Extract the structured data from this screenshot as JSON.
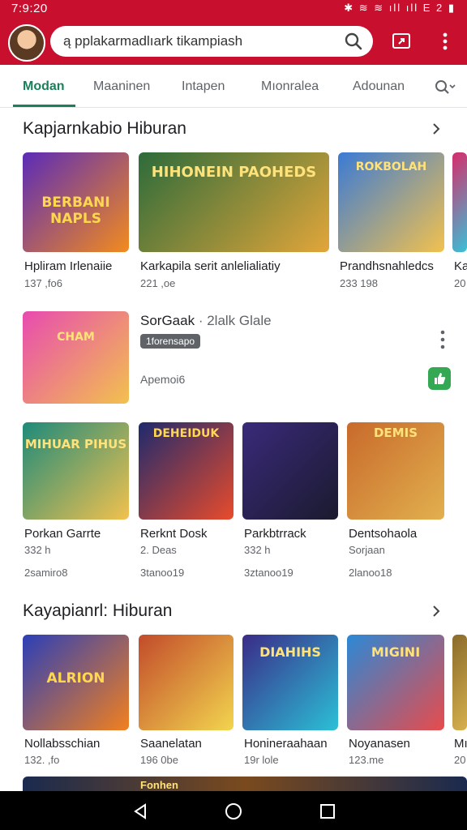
{
  "status_bar": {
    "time": "7:9:20",
    "icons": "✱ ≋ ≋ ıll ıll E 2 ▮"
  },
  "search": {
    "query": "ą pplakarmadlıark tikampiash"
  },
  "tabs": [
    "Modan",
    "Maaninen",
    "Intapen",
    "Mıonralea",
    "Adounan"
  ],
  "colors": {
    "brand": "#c8102e",
    "accent": "#1a7f5a",
    "install": "#34a853"
  },
  "sections": [
    {
      "title": "Kapjarnkabio Hiburan",
      "items": [
        {
          "name": "Hpliram Irlenaiie",
          "meta": "137 ,fo6",
          "art": "BERBANI NAPLS",
          "c1": "#5b2bb8",
          "c2": "#f28b1e"
        },
        {
          "name": "Karkapila serit anlelialiatiy",
          "meta": "221 ,oe",
          "art": "HIHONEIN PAOHEDS",
          "c1": "#2d6b3a",
          "c2": "#e2a63a"
        },
        {
          "name": "Prandhsnahledcs",
          "meta": "233 198",
          "art": "ROKBOLAH",
          "c1": "#3a7ad6",
          "c2": "#f2c14e"
        },
        {
          "name": "Ka",
          "meta": "20",
          "art": "",
          "c1": "#d62d6b",
          "c2": "#3ac0d6"
        }
      ]
    },
    {
      "title": "Kayapianrl: Hiburan",
      "items": [
        {
          "name": "Nollabsschian",
          "meta": "132. ,fo",
          "art": "ALRION",
          "c1": "#2b3fb8",
          "c2": "#f2801e"
        },
        {
          "name": "Saanelatan",
          "meta": "196 0be",
          "art": "",
          "c1": "#c24b2b",
          "c2": "#f2d54e"
        },
        {
          "name": "Honineraahaan",
          "meta": "19r lole",
          "art": "DIAHIHS",
          "c1": "#3a2b88",
          "c2": "#2bc0d6"
        },
        {
          "name": "Noyanasen",
          "meta": "123.me",
          "art": "MIGINI",
          "c1": "#2b88d6",
          "c2": "#e84b4b"
        },
        {
          "name": "Mı",
          "meta": "20",
          "art": "",
          "c1": "#8a6b2b",
          "c2": "#d6b04e"
        }
      ]
    }
  ],
  "featured": {
    "name": "SorGaak",
    "subtitle": "· 2lalk Glale",
    "badge": "1forensapo",
    "meta": "Apemoi6",
    "art": "CHAM"
  },
  "grid_row": [
    {
      "name": "Porkan Garrte",
      "meta1": "332 h",
      "meta2": "2samiro8",
      "art": "MIHUAR PIHUS",
      "c1": "#1d8a7a",
      "c2": "#f2c14e"
    },
    {
      "name": "Rerknt Dosk",
      "meta1": "2. Deas",
      "meta2": "3tanoo19",
      "art": "DEHEIDUK",
      "c1": "#1e2a6e",
      "c2": "#e84b2b"
    },
    {
      "name": "Parkbtrrack",
      "meta1": "332 h",
      "meta2": "3ztanoo19",
      "art": "",
      "c1": "#3a2a7a",
      "c2": "#1a1a2e"
    },
    {
      "name": "Dentsohaola",
      "meta1": "Sorjaan",
      "meta2": "2lanoo18",
      "art": "DEMIS",
      "c1": "#c86a2b",
      "c2": "#e2b04e"
    }
  ],
  "bottom_banner": {
    "label": "Fonhen"
  },
  "nav": {
    "back": "◁",
    "home": "○",
    "recents": "□"
  }
}
